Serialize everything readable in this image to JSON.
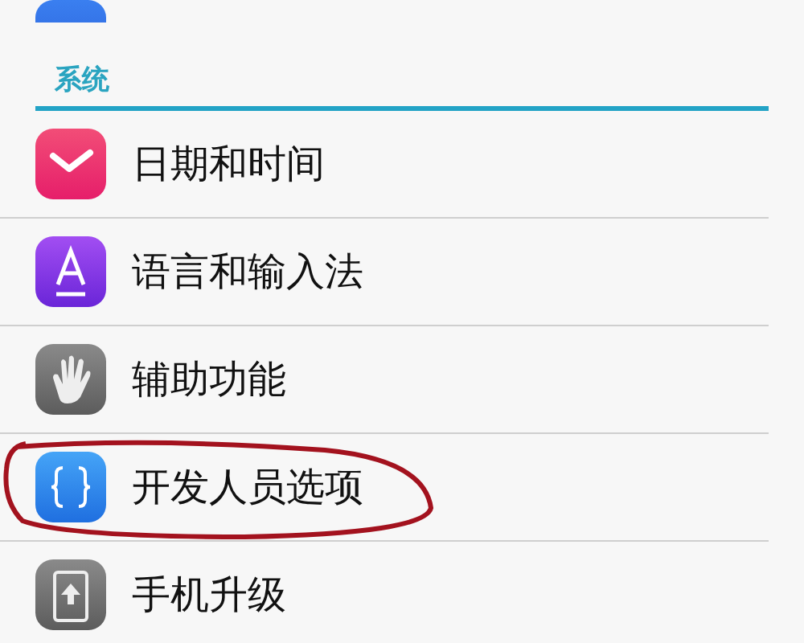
{
  "section": {
    "title": "系统"
  },
  "items": [
    {
      "kind": "cut"
    },
    {
      "kind": "header"
    },
    {
      "kind": "row",
      "label": "日期和时间",
      "annotated": false
    },
    {
      "kind": "row",
      "label": "语言和输入法",
      "annotated": false
    },
    {
      "kind": "row",
      "label": "辅助功能",
      "annotated": false
    },
    {
      "kind": "row",
      "label": "开发人员选项",
      "annotated": true
    },
    {
      "kind": "row",
      "label": "手机升级",
      "annotated": false
    }
  ]
}
